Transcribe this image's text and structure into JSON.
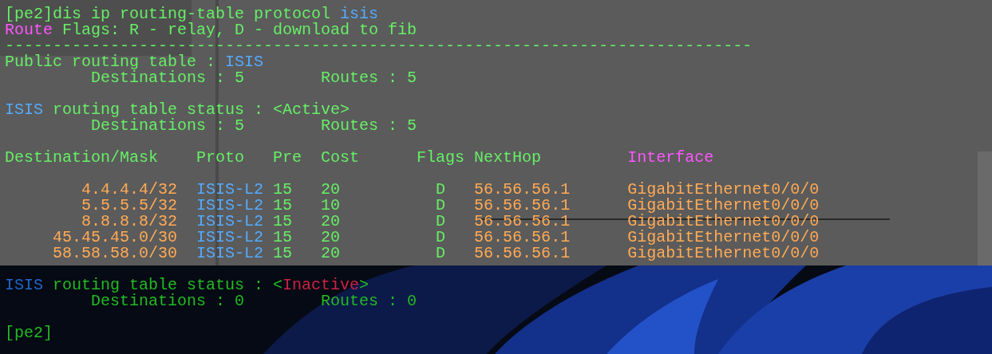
{
  "terminal": {
    "lines": [
      {
        "segments": [
          {
            "text": "[pe2]dis ip routing-table protocol ",
            "color": "#66ee66"
          },
          {
            "text": "isis",
            "color": "#55aaff"
          }
        ]
      },
      {
        "segments": [
          {
            "text": "Route",
            "color": "#ff55ff"
          },
          {
            "text": " Flags: R - relay, D - download to fib",
            "color": "#66ee66"
          }
        ]
      },
      {
        "segments": [
          {
            "text": "------------------------------------------------------------------------------",
            "color": "#66ee66"
          }
        ]
      },
      {
        "segments": [
          {
            "text": "Public routing table : ",
            "color": "#66ee66"
          },
          {
            "text": "ISIS",
            "color": "#55aaff"
          }
        ]
      },
      {
        "segments": [
          {
            "text": "         Destinations : 5        Routes : 5",
            "color": "#66ee66"
          }
        ]
      },
      {
        "kind": "blank"
      },
      {
        "segments": [
          {
            "text": "ISIS",
            "color": "#55aaff"
          },
          {
            "text": " routing table status : <Active>",
            "color": "#66ee66"
          }
        ]
      },
      {
        "segments": [
          {
            "text": "         Destinations : 5        Routes : 5",
            "color": "#66ee66"
          }
        ]
      },
      {
        "kind": "blank"
      },
      {
        "segments": [
          {
            "text": "Destination/Mask    Proto   Pre  Cost      Flags NextHop         ",
            "color": "#66ee66"
          },
          {
            "text": "Interface",
            "color": "#ff55ff"
          }
        ]
      },
      {
        "kind": "blank"
      },
      {
        "segments": [
          {
            "text": "        4.4.4.4/32  ",
            "color": "#ffaa55"
          },
          {
            "text": "ISIS-L2 ",
            "color": "#55aaff"
          },
          {
            "text": "15   20          D   ",
            "color": "#66ee66"
          },
          {
            "text": "56.56.56.1      GigabitEthernet0/0/0",
            "color": "#ffaa55"
          }
        ]
      },
      {
        "segments": [
          {
            "text": "        5.5.5.5/32  ",
            "color": "#ffaa55"
          },
          {
            "text": "ISIS-L2 ",
            "color": "#55aaff"
          },
          {
            "text": "15   10          D   ",
            "color": "#66ee66"
          },
          {
            "text": "56.56.56.1      GigabitEthernet0/0/0",
            "color": "#ffaa55"
          }
        ]
      },
      {
        "segments": [
          {
            "text": "        8.8.8.8/32  ",
            "color": "#ffaa55"
          },
          {
            "text": "ISIS-L2 ",
            "color": "#55aaff"
          },
          {
            "text": "15   20          D   ",
            "color": "#66ee66"
          },
          {
            "text": "56.56.56.1      GigabitEthernet0/0/0",
            "color": "#ffaa55"
          }
        ]
      },
      {
        "segments": [
          {
            "text": "     45.45.45.0/30  ",
            "color": "#ffaa55"
          },
          {
            "text": "ISIS-L2 ",
            "color": "#55aaff"
          },
          {
            "text": "15   20          D   ",
            "color": "#66ee66"
          },
          {
            "text": "56.56.56.1      GigabitEthernet0/0/0",
            "color": "#ffaa55"
          }
        ]
      },
      {
        "segments": [
          {
            "text": "     58.58.58.0/30  ",
            "color": "#ffaa55"
          },
          {
            "text": "ISIS-L2 ",
            "color": "#55aaff"
          },
          {
            "text": "15   20          D   ",
            "color": "#66ee66"
          },
          {
            "text": "56.56.56.1      GigabitEthernet0/0/0",
            "color": "#ffaa55"
          }
        ]
      },
      {
        "kind": "blank"
      },
      {
        "segments": [
          {
            "text": "ISIS",
            "color": "#2266cc"
          },
          {
            "text": " routing table status : <",
            "color": "#22bb22"
          },
          {
            "text": "Inactive",
            "color": "#cc2244"
          },
          {
            "text": ">",
            "color": "#22bb22"
          }
        ]
      },
      {
        "segments": [
          {
            "text": "         Destinations : 0        Routes : 0",
            "color": "#22bb22"
          }
        ]
      },
      {
        "kind": "blank"
      },
      {
        "segments": [
          {
            "text": "[pe2]",
            "color": "#22bb22"
          }
        ]
      }
    ]
  }
}
